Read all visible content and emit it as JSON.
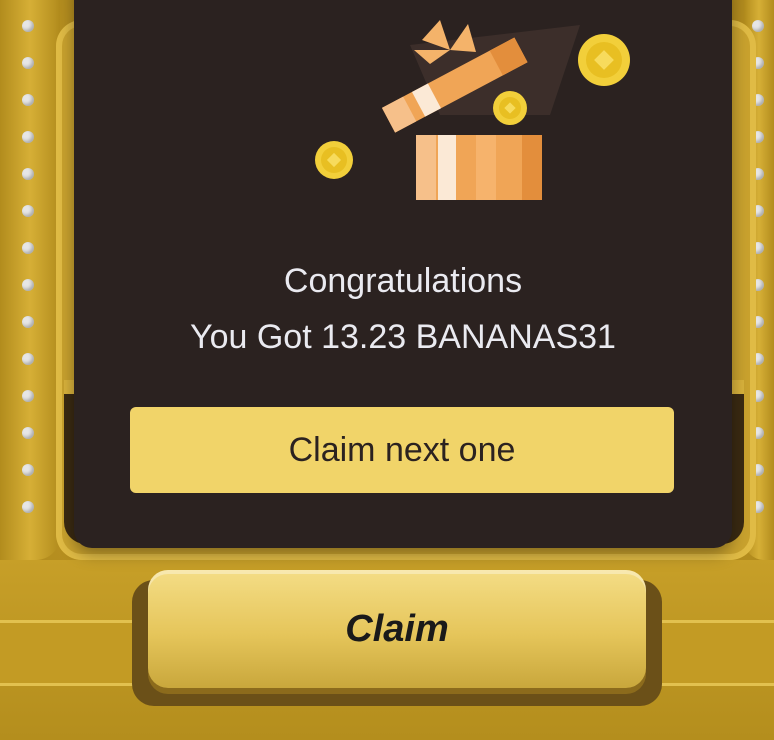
{
  "modal": {
    "title": "Congratulations",
    "message": "You Got 13.23 BANANAS31",
    "claim_next_label": "Claim next one"
  },
  "machine": {
    "claim_label": "Claim"
  },
  "icons": {
    "gift": "open-gift-box-icon",
    "coin": "gold-coin-icon"
  },
  "colors": {
    "modal_bg": "#2b2220",
    "accent_button": "#f1d469",
    "machine_gold": "#c49b26"
  }
}
